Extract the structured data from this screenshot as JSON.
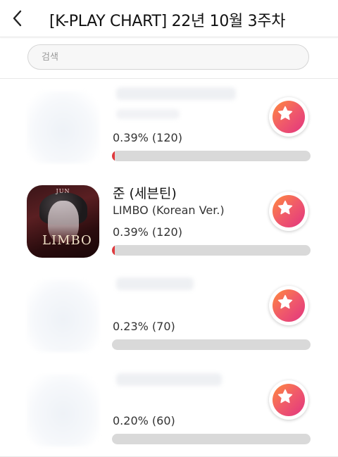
{
  "header": {
    "title": "[K-PLAY CHART] 22년 10월 3주차",
    "back_icon": "chevron-left-icon"
  },
  "search": {
    "placeholder": "검색"
  },
  "colors": {
    "vote_gradient_start": "#ff8a3c",
    "vote_gradient_end": "#e2357f",
    "progress_fill": "#e03a3e",
    "progress_track": "#d9d9d9"
  },
  "items": [
    {
      "percent_text": "0.39% (120)",
      "progress": 0.0039
    },
    {
      "artist": "준 (세븐틴)",
      "song": "LIMBO (Korean Ver.)",
      "percent_text": "0.39% (120)",
      "progress": 0.0039,
      "cover_lettering": "JUN",
      "cover_title": "LIMBO"
    },
    {
      "percent_text": "0.23% (70)",
      "progress": 0
    },
    {
      "percent_text": "0.20% (60)",
      "progress": 0
    }
  ]
}
